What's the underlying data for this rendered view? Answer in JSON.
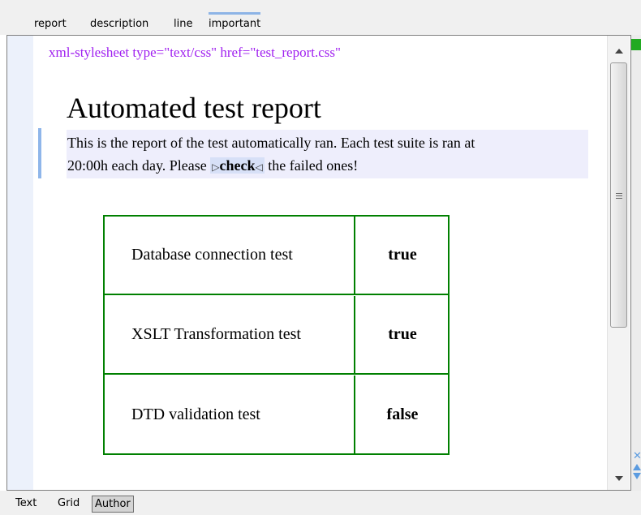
{
  "breadcrumb": {
    "items": [
      {
        "label": "report"
      },
      {
        "label": "description"
      },
      {
        "label": "line"
      },
      {
        "label": "important"
      }
    ],
    "active": "important"
  },
  "document": {
    "processing_instruction": "xml-stylesheet type=\"text/css\" href=\"test_report.css\"",
    "title": "Automated test report",
    "description_line1": "This is the report of the test automatically ran. Each test suite is ran at",
    "description_before": "20:00h each day. Please",
    "description_important": "check",
    "description_after": "the failed ones!",
    "start_tag_glyph": "▷",
    "end_tag_glyph": "◁"
  },
  "results": {
    "rows": [
      {
        "name": "Database connection test",
        "value": "true"
      },
      {
        "name": "XSLT Transformation test",
        "value": "true"
      },
      {
        "name": "DTD validation test",
        "value": "false"
      }
    ]
  },
  "modes": {
    "tabs": [
      {
        "label": "Text"
      },
      {
        "label": "Grid"
      },
      {
        "label": "Author"
      }
    ],
    "active": "Author"
  },
  "icons": {
    "scroll_up": "arrow-up-icon",
    "scroll_down": "arrow-down-icon",
    "scroll_grip": "grip-icon",
    "status": "status-ok-icon",
    "navigation": "navigation-icon"
  },
  "colors": {
    "table_border": "#008000",
    "processing_instruction": "#a020f0",
    "paragraph_highlight": "#eeeefc",
    "important_highlight": "#d7e0f7",
    "active_crumb_accent": "#8db4e6"
  }
}
